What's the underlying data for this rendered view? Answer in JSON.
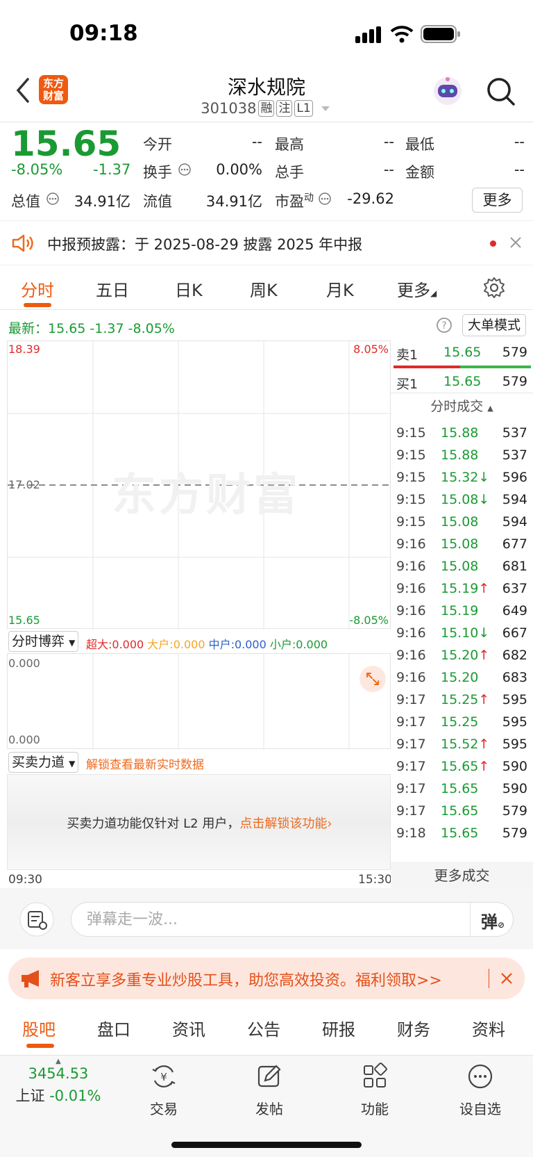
{
  "status": {
    "time": "09:18"
  },
  "header": {
    "logo_text_1": "东方",
    "logo_text_2": "财富",
    "stock_name": "深水规院",
    "stock_code": "301038",
    "tags": [
      "融",
      "注",
      "L1"
    ]
  },
  "quote": {
    "price": "15.65",
    "change_pct": "-8.05%",
    "change": "-1.37",
    "open_label": "今开",
    "open": "--",
    "high_label": "最高",
    "high": "--",
    "low_label": "最低",
    "low": "--",
    "turnover_label": "换手",
    "turnover": "0.00%",
    "volume_label": "总手",
    "volume": "--",
    "amount_label": "金额",
    "amount": "--",
    "mcap_label": "总值",
    "mcap": "34.91亿",
    "float_label": "流值",
    "float": "34.91亿",
    "pe_label": "市盈",
    "pe_sup": "动",
    "pe": "-29.62",
    "more_label": "更多"
  },
  "notice": {
    "text": "中报预披露：于 2025-08-29 披露 2025 年中报"
  },
  "chart_tabs": [
    "分时",
    "五日",
    "日K",
    "周K",
    "月K",
    "更多"
  ],
  "latest": {
    "text": "最新：15.65  -1.37  -8.05%",
    "bigorder_label": "大单模式"
  },
  "chart": {
    "y_top": "18.39",
    "y_mid": "17.02",
    "y_bottom": "15.65",
    "pct_top": "8.05%",
    "pct_bottom": "-8.05%",
    "watermark": "东方财富",
    "x_start": "09:30",
    "x_end": "15:30"
  },
  "bobo": {
    "label": "分时博弈",
    "chaoda": "超大:0.000",
    "dahu": "大户:0.000",
    "zhonghu": "中户:0.000",
    "xiaohu": "小户:0.000",
    "y_top": "0.000",
    "y_bottom": "0.000"
  },
  "force": {
    "label": "买卖力道",
    "unlock_hint": "解锁查看最新实时数据",
    "msg": "买卖力道功能仅针对 L2 用户，",
    "msg_link": "点击解锁该功能"
  },
  "orderbook": {
    "sell": {
      "label": "卖1",
      "price": "15.65",
      "vol": "579"
    },
    "buy": {
      "label": "买1",
      "price": "15.65",
      "vol": "579"
    },
    "ticks_title": "分时成交",
    "ticks": [
      {
        "t": "9:15",
        "p": "15.88",
        "a": "",
        "v": "537"
      },
      {
        "t": "9:15",
        "p": "15.88",
        "a": "",
        "v": "537"
      },
      {
        "t": "9:15",
        "p": "15.32",
        "a": "↓",
        "v": "596"
      },
      {
        "t": "9:15",
        "p": "15.08",
        "a": "↓",
        "v": "594"
      },
      {
        "t": "9:15",
        "p": "15.08",
        "a": "",
        "v": "594"
      },
      {
        "t": "9:16",
        "p": "15.08",
        "a": "",
        "v": "677"
      },
      {
        "t": "9:16",
        "p": "15.08",
        "a": "",
        "v": "681"
      },
      {
        "t": "9:16",
        "p": "15.19",
        "a": "↑",
        "v": "637"
      },
      {
        "t": "9:16",
        "p": "15.19",
        "a": "",
        "v": "649"
      },
      {
        "t": "9:16",
        "p": "15.10",
        "a": "↓",
        "v": "667"
      },
      {
        "t": "9:16",
        "p": "15.20",
        "a": "↑",
        "v": "682"
      },
      {
        "t": "9:16",
        "p": "15.20",
        "a": "",
        "v": "683"
      },
      {
        "t": "9:17",
        "p": "15.25",
        "a": "↑",
        "v": "595"
      },
      {
        "t": "9:17",
        "p": "15.25",
        "a": "",
        "v": "595"
      },
      {
        "t": "9:17",
        "p": "15.52",
        "a": "↑",
        "v": "595"
      },
      {
        "t": "9:17",
        "p": "15.65",
        "a": "↑",
        "v": "590"
      },
      {
        "t": "9:17",
        "p": "15.65",
        "a": "",
        "v": "590"
      },
      {
        "t": "9:17",
        "p": "15.65",
        "a": "",
        "v": "579"
      },
      {
        "t": "9:18",
        "p": "15.65",
        "a": "",
        "v": "579"
      }
    ],
    "more_ticks": "更多成交"
  },
  "danmaku": {
    "placeholder": "弹幕走一波...",
    "send_label": "弹"
  },
  "promo": {
    "text": "新客立享多重专业炒股工具，助您高效投资。福利领取>>"
  },
  "bottom_tabs": [
    "股吧",
    "盘口",
    "资讯",
    "公告",
    "研报",
    "财务",
    "资料"
  ],
  "nav": {
    "index_value": "3454.53",
    "index_name": "上证",
    "index_change": "-0.01%",
    "items": [
      "交易",
      "发帖",
      "功能",
      "设自选"
    ]
  },
  "colors": {
    "accent": "#ee5a10",
    "down": "#1a9a33",
    "up": "#e02a2a"
  }
}
